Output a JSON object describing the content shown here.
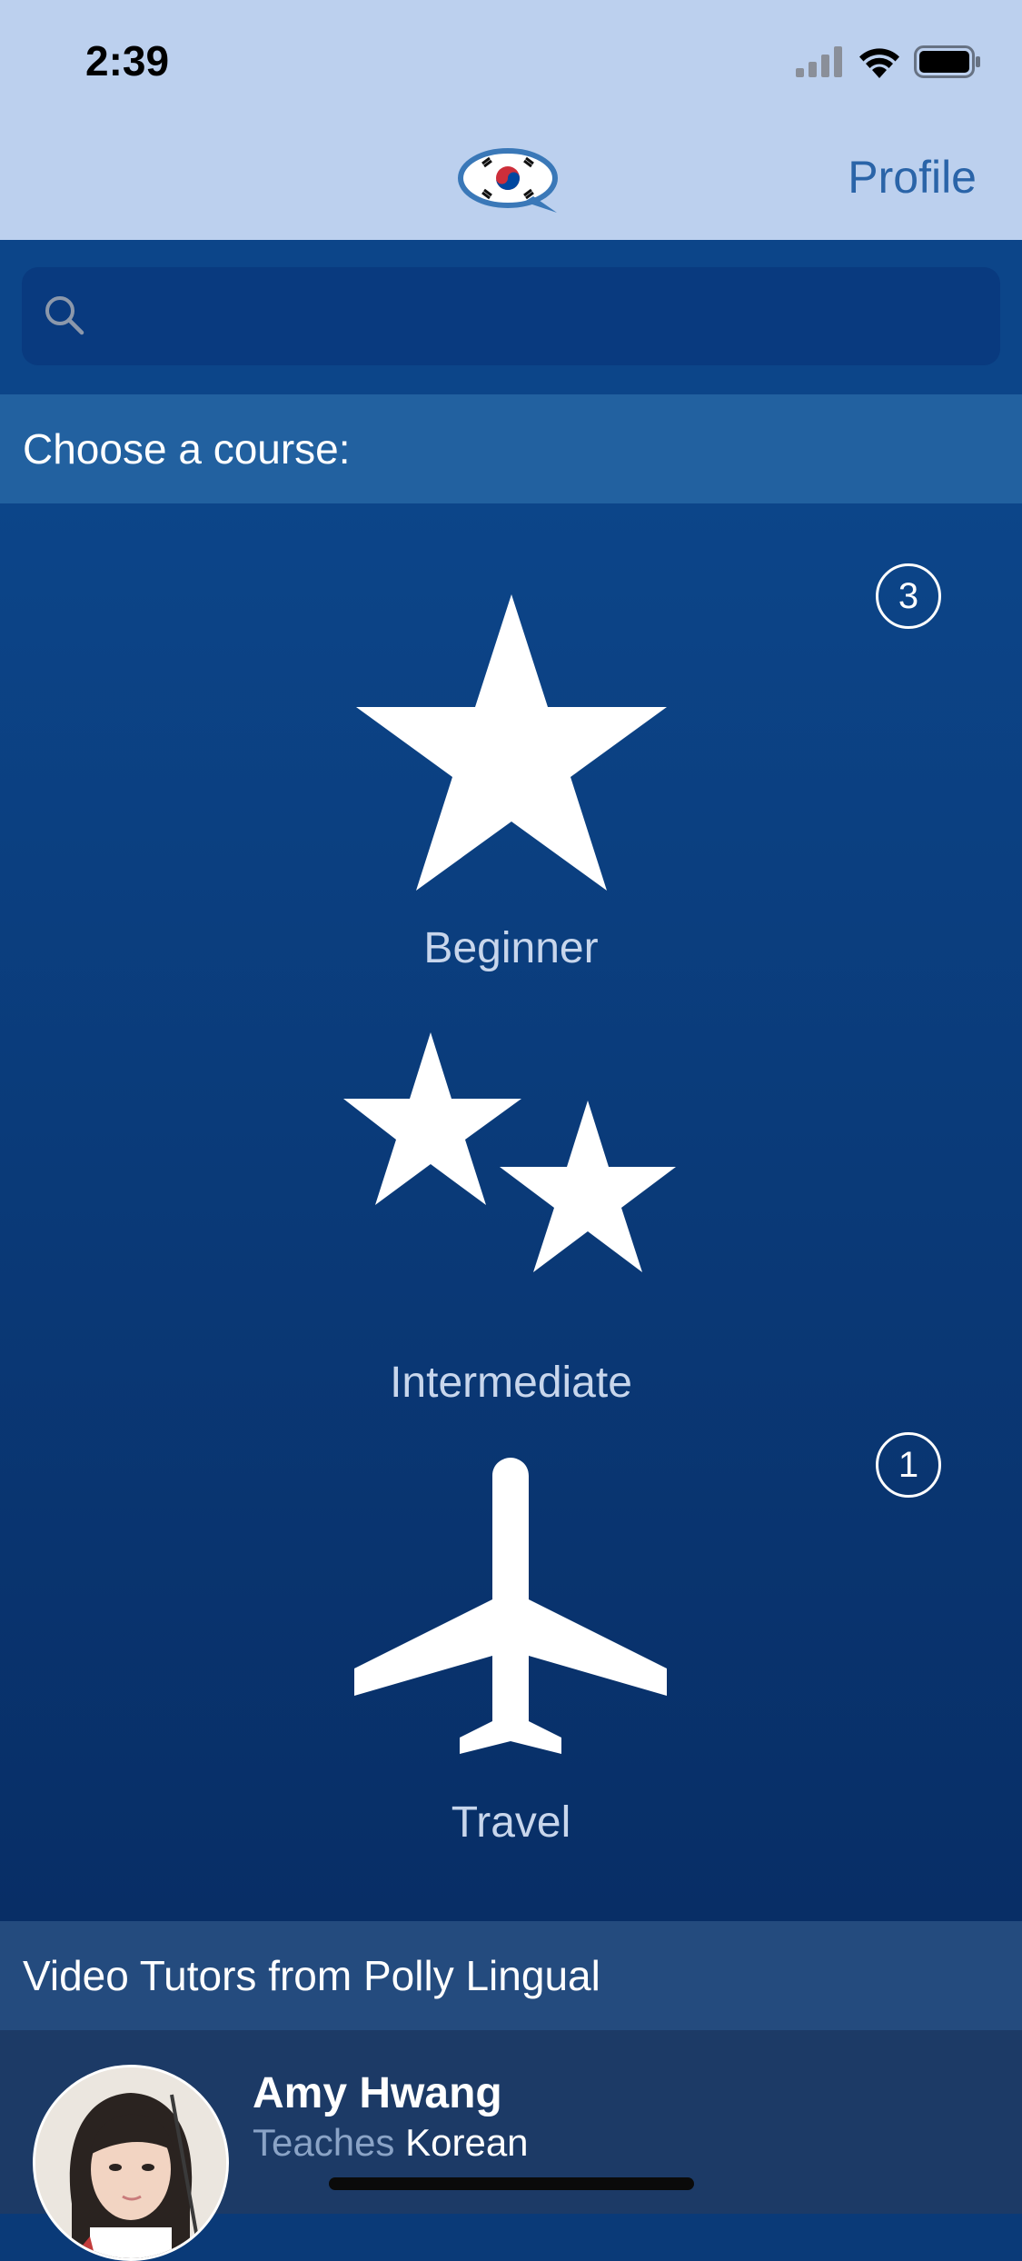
{
  "status_bar": {
    "time": "2:39",
    "icons": [
      "cellular-signal-icon",
      "wifi-icon",
      "battery-icon"
    ]
  },
  "nav": {
    "logo": "korean-flag-speech-bubble-logo",
    "profile_label": "Profile"
  },
  "search": {
    "placeholder": "",
    "value": ""
  },
  "courses": {
    "header": "Choose a course:",
    "items": [
      {
        "label": "Beginner",
        "icon": "star-icon",
        "badge": "3"
      },
      {
        "label": "Intermediate",
        "icon": "two-stars-icon",
        "badge": ""
      },
      {
        "label": "Travel",
        "icon": "airplane-icon",
        "badge": "1"
      }
    ]
  },
  "tutors": {
    "header": "Video Tutors from Polly Lingual",
    "items": [
      {
        "name": "Amy Hwang",
        "teaches_prefix": "Teaches",
        "language": "Korean"
      }
    ]
  },
  "colors": {
    "nav_background": "#bcd0ee",
    "accent": "#2a64a8",
    "main_background": "#0c4589",
    "section_header": "#2261a0"
  }
}
